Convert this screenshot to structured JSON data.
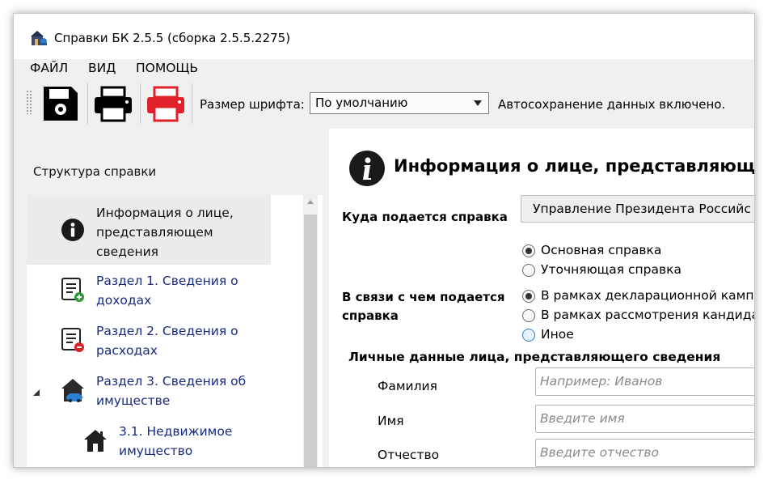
{
  "window": {
    "title": "Справки БК 2.5.5 (сборка 2.5.5.2275)"
  },
  "menu": [
    "ФАЙЛ",
    "ВИД",
    "ПОМОЩЬ"
  ],
  "toolbar": {
    "buttons": [
      {
        "name": "save-icon",
        "color": "#000000"
      },
      {
        "name": "print-icon",
        "color": "#000000"
      },
      {
        "name": "print-red-icon",
        "color": "#e0202a"
      }
    ],
    "font_size_label": "Размер шрифта:",
    "font_size_value": "По умолчанию",
    "autosave_text": "Автосохранение данных включено."
  },
  "sidebar": {
    "title": "Структура справки",
    "items": [
      {
        "label": "Информация о лице, представляющем сведения",
        "lines": [
          "Информация о лице,",
          "представляющем",
          "сведения"
        ],
        "icon": "info-icon",
        "selected": true
      },
      {
        "label": "Раздел 1. Сведения о доходах",
        "lines": [
          "Раздел 1. Сведения о",
          "доходах"
        ],
        "icon": "income-list-icon"
      },
      {
        "label": "Раздел 2. Сведения о расходах",
        "lines": [
          "Раздел 2. Сведения о",
          "расходах"
        ],
        "icon": "expense-list-icon"
      },
      {
        "label": "Раздел 3. Сведения об имуществе",
        "lines": [
          "Раздел 3. Сведения об",
          "имуществе"
        ],
        "icon": "property-icon",
        "expanded": true
      },
      {
        "label": "3.1. Недвижимое имущество",
        "lines": [
          "3.1. Недвижимое",
          "имущество"
        ],
        "icon": "house-icon"
      }
    ]
  },
  "main": {
    "title": "Информация о лице, представляюще",
    "destination_label": "Куда подается справка",
    "destination_value": "Управление Президента Российс",
    "report_types": [
      {
        "label": "Основная справка",
        "checked": true
      },
      {
        "label": "Уточняющая справка",
        "checked": false
      }
    ],
    "reason_label": "В связи с чем подается справка",
    "reason_lines": [
      "В связи с чем подается",
      "справка"
    ],
    "reasons": [
      {
        "label": "В рамках декларационной камп",
        "checked": true
      },
      {
        "label": "В рамках рассмотрения кандида",
        "checked": false
      },
      {
        "label": "Иное",
        "checked": false,
        "focused": true
      }
    ],
    "personal_section": "Личные данные лица, представляющего сведения",
    "fields": [
      {
        "label": "Фамилия",
        "placeholder": "Например:  Иванов"
      },
      {
        "label": "Имя",
        "placeholder": "Введите имя"
      },
      {
        "label": "Отчество",
        "placeholder": "Введите отчество"
      }
    ]
  }
}
